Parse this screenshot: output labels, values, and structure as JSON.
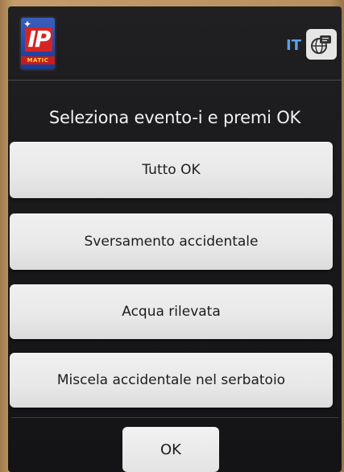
{
  "header": {
    "logo_text": "IP",
    "logo_subtext": "MATIC",
    "language_code": "IT",
    "language_icon": "globe-chat-icon"
  },
  "prompt": "Seleziona evento-i e premi OK",
  "events": [
    {
      "label": "Tutto OK"
    },
    {
      "label": "Sversamento accidentale"
    },
    {
      "label": "Acqua rilevata"
    },
    {
      "label": "Miscela accidentale nel serbatoio"
    }
  ],
  "ok_button": {
    "label": "OK"
  },
  "colors": {
    "screen_bg": "#1a1a1c",
    "button_bg": "#ececec",
    "accent_blue": "#5aa0e6",
    "logo_red": "#d42424",
    "logo_blue": "#2446a8"
  }
}
